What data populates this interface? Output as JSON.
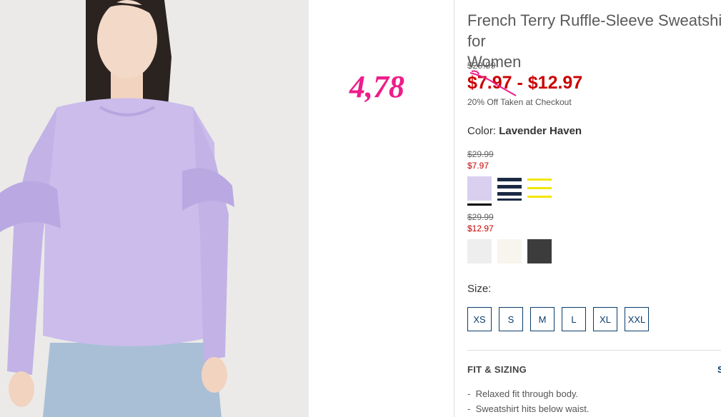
{
  "product": {
    "title": "French Terry Ruffle-Sleeve Sweatshirt for\nWomen",
    "original_price": "$29.99",
    "sale_price": "$7.97 - $12.97",
    "promo": "20% Off Taken at Checkout",
    "color_label": "Color:",
    "color_value": "Lavender Haven"
  },
  "annotation": "4,78",
  "color_groups": [
    {
      "original_price": "$29.99",
      "sale_price": "$7.97",
      "swatches": [
        {
          "name": "lavender",
          "color": "#d9d0f0",
          "selected": true
        },
        {
          "name": "navy-stripe",
          "color": "#1b2a44",
          "selected": false
        },
        {
          "name": "yellow-stripe",
          "color": "#f2e600",
          "selected": false
        }
      ]
    },
    {
      "original_price": "$29.99",
      "sale_price": "$12.97",
      "swatches": [
        {
          "name": "light-gray",
          "color": "#f0f0f0",
          "selected": false
        },
        {
          "name": "cream",
          "color": "#f7f5ee",
          "selected": false
        },
        {
          "name": "charcoal",
          "color": "#3c3c3c",
          "selected": false
        }
      ]
    }
  ],
  "size_label": "Size:",
  "sizes": [
    "XS",
    "S",
    "M",
    "L",
    "XL",
    "XXL"
  ],
  "fit": {
    "heading": "FIT & SIZING",
    "toggle": "S",
    "items": [
      "Relaxed fit through body.",
      "Sweatshirt hits below waist."
    ]
  },
  "colors": {
    "sale_red": "#cc0000",
    "accent_navy": "#0b3d6e",
    "annotation_pink": "#ee1d8a"
  }
}
